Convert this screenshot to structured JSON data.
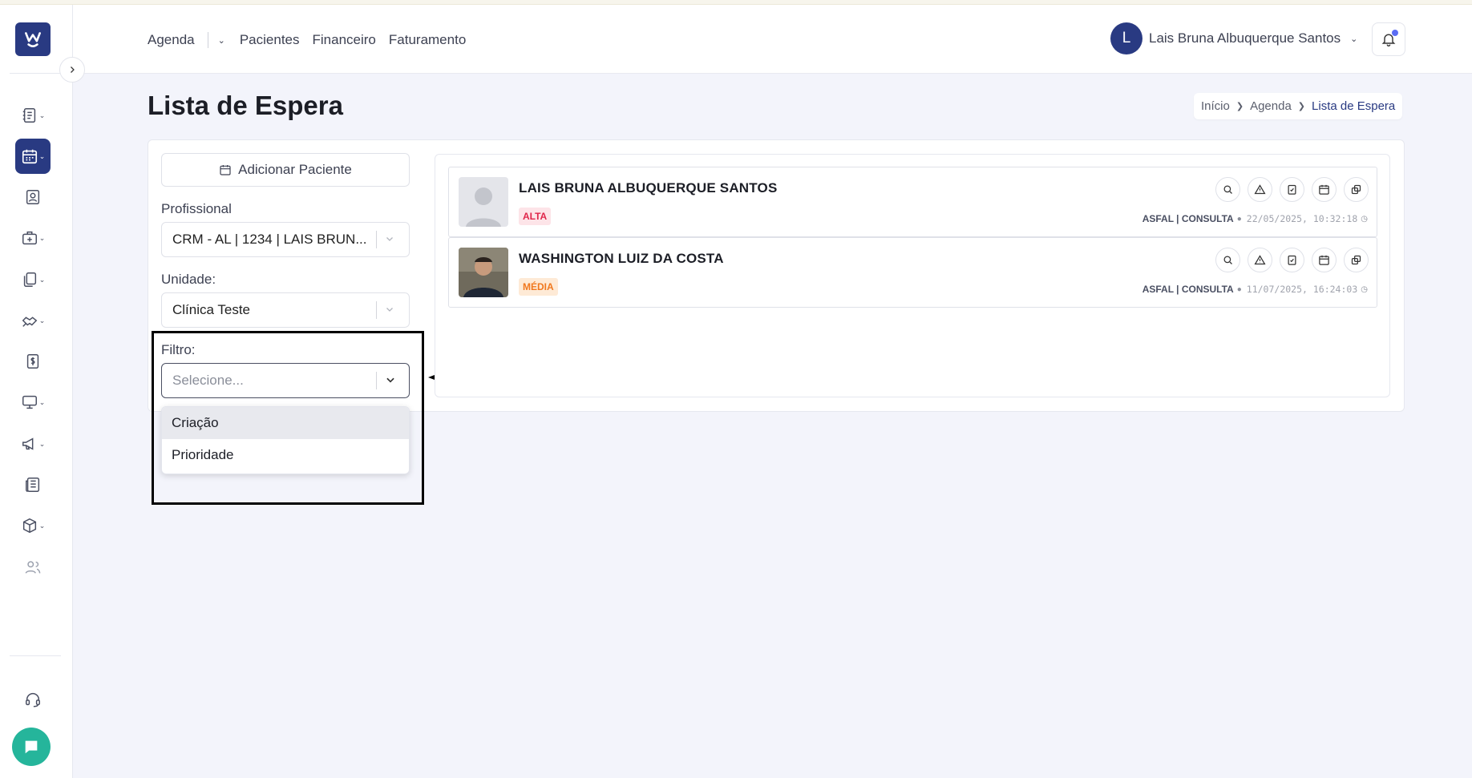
{
  "nav": {
    "items": [
      "Agenda",
      "Pacientes",
      "Financeiro",
      "Faturamento"
    ]
  },
  "user": {
    "initial": "L",
    "name": "Lais Bruna Albuquerque Santos"
  },
  "page": {
    "title": "Lista de Espera",
    "breadcrumb": [
      "Início",
      "Agenda",
      "Lista de Espera"
    ]
  },
  "form": {
    "add_button": "Adicionar Paciente",
    "profissional_label": "Profissional",
    "profissional_value": "CRM - AL | 1234 | LAIS BRUN...",
    "unidade_label": "Unidade:",
    "unidade_value": "Clínica Teste",
    "filtro_label": "Filtro:",
    "filtro_placeholder": "Selecione...",
    "filtro_options": [
      "Criação",
      "Prioridade"
    ]
  },
  "patients": [
    {
      "name": "LAIS BRUNA ALBUQUERQUE SANTOS",
      "priority": "ALTA",
      "tipo": "ASFAL | CONSULTA",
      "timestamp": "22/05/2025, 10:32:18"
    },
    {
      "name": "WASHINGTON LUIZ DA COSTA",
      "priority": "MÉDIA",
      "tipo": "ASFAL | CONSULTA",
      "timestamp": "11/07/2025, 16:24:03"
    }
  ],
  "colors": {
    "brand": "#293a82",
    "alta": "#e0254a",
    "media": "#f0781e",
    "chat": "#25b59b"
  }
}
